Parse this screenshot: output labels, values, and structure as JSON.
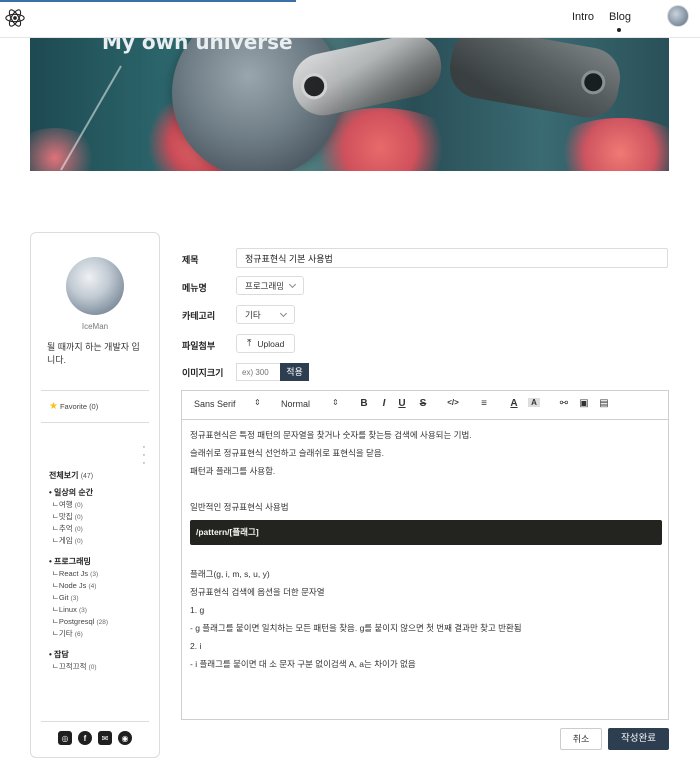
{
  "nav": {
    "links": [
      "Intro",
      "Blog"
    ],
    "active": "Blog"
  },
  "banner": {
    "title": "My own universe"
  },
  "sidebar": {
    "name": "IceMan",
    "bio": "될 때까지 하는 개발자 입니다.",
    "favorite_label": "Favorite",
    "favorite_count": "(0)",
    "all_label": "전체보기",
    "all_count": "(47)",
    "categories": [
      {
        "title": "일상의 순간",
        "items": [
          {
            "label": "ㄴ여행",
            "count": "(0)"
          },
          {
            "label": "ㄴ맛집",
            "count": "(0)"
          },
          {
            "label": "ㄴ추억",
            "count": "(0)"
          },
          {
            "label": "ㄴ게임",
            "count": "(0)"
          }
        ]
      },
      {
        "title": "프로그래밍",
        "items": [
          {
            "label": "ㄴReact Js",
            "count": "(3)"
          },
          {
            "label": "ㄴNode Js",
            "count": "(4)"
          },
          {
            "label": "ㄴGit",
            "count": "(3)"
          },
          {
            "label": "ㄴLinux",
            "count": "(3)"
          },
          {
            "label": "ㄴPostgresql",
            "count": "(28)"
          },
          {
            "label": "ㄴ기타",
            "count": "(6)"
          }
        ]
      },
      {
        "title": "잡담",
        "items": [
          {
            "label": "ㄴ끄적끄적",
            "count": "(0)"
          }
        ]
      }
    ],
    "socials": [
      "instagram-icon",
      "facebook-icon",
      "mail-icon",
      "github-icon"
    ]
  },
  "form": {
    "title_label": "제목",
    "title_value": "정규표현식 기본 사용법",
    "menu_label": "메뉴명",
    "menu_value": "프로그래밍",
    "category_label": "카테고리",
    "category_value": "기타",
    "file_label": "파일첨부",
    "upload_label": "Upload",
    "image_size_label": "이미지크기",
    "image_size_placeholder": "ex) 300",
    "apply_label": "적용"
  },
  "editor": {
    "font": "Sans Serif",
    "size": "Normal",
    "lines_top": [
      "정규표현식은 특정 패턴의 문자열을 찾거나 숫자를 찾는등 검색에 사용되는 기법.",
      "슬래쉬로 정규표현식 선언하고 슬래쉬로 표현식을 닫음.",
      "패턴과 플래그를 사용함."
    ],
    "subheading": "일반적인 정규표현식 사용법",
    "code": "/pattern/[플래그]",
    "lines_bottom": [
      "플래그(g, i, m, s, u, y)",
      "정규표현식 검색에 옵션을 더한 문자열",
      "1. g",
      "- g 플래그를 붙이면 일치하는 모든 패턴을 찾음. g를 붙이지 않으면 첫 번째 결과만 찾고 반환됨",
      "2. i",
      "- i 플래그를 붙이면 대 소 문자 구분 없이검색 A, a는 차이가 없음"
    ]
  },
  "actions": {
    "cancel": "취소",
    "submit": "작성완료"
  },
  "colors": {
    "accent": "#2c3e50",
    "code_bg": "#23241f",
    "star": "#f4c21b"
  }
}
